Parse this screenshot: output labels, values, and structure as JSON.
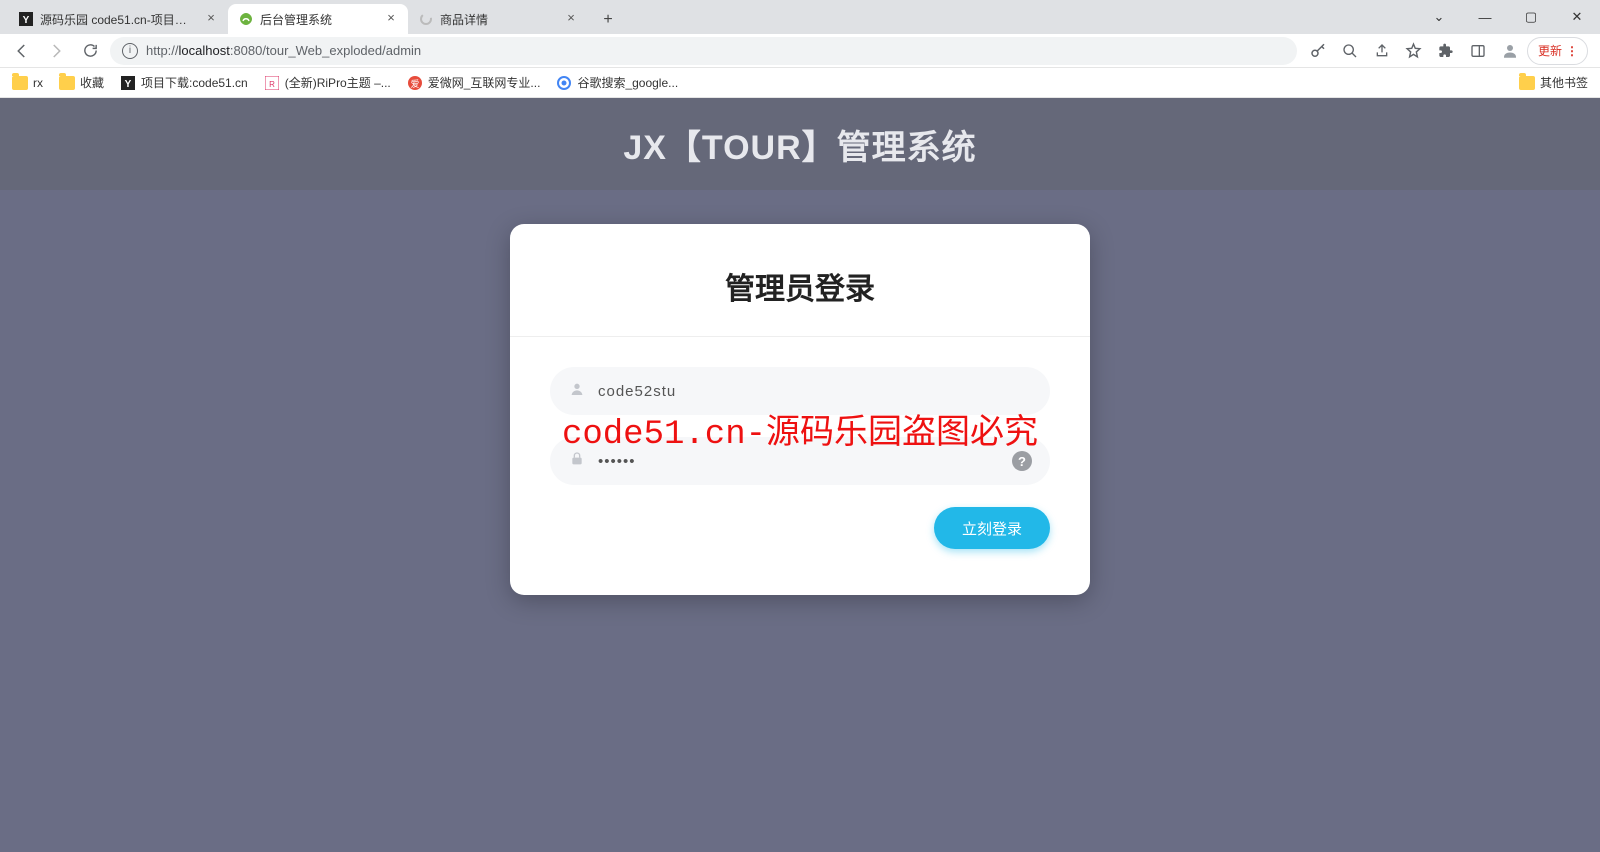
{
  "browser": {
    "tabs": [
      {
        "title": "源码乐园 code51.cn-项目论文代",
        "active": false
      },
      {
        "title": "后台管理系统",
        "active": true
      },
      {
        "title": "商品详情",
        "active": false
      }
    ],
    "url_host": "localhost",
    "url_port": ":8080",
    "url_path": "/tour_Web_exploded/admin",
    "url_prefix": "http://",
    "update_label": "更新",
    "window": {
      "min": "—",
      "max": "▢",
      "close": "✕",
      "drop": "⌄"
    }
  },
  "bookmarks": {
    "items": [
      {
        "label": "rx",
        "icon": "folder"
      },
      {
        "label": "收藏",
        "icon": "folder"
      },
      {
        "label": "项目下载:code51.cn",
        "icon": "y"
      },
      {
        "label": "(全新)RiPro主题 –...",
        "icon": "ri"
      },
      {
        "label": "爱微网_互联网专业...",
        "icon": "ai"
      },
      {
        "label": "谷歌搜索_google...",
        "icon": "g"
      }
    ],
    "other": "其他书签"
  },
  "page": {
    "header_title": "JX【TOUR】管理系统",
    "card_title": "管理员登录",
    "username_value": "code52stu",
    "password_value": "••••••",
    "submit_label": "立刻登录"
  },
  "watermark": "code51.cn-源码乐园盗图必究"
}
